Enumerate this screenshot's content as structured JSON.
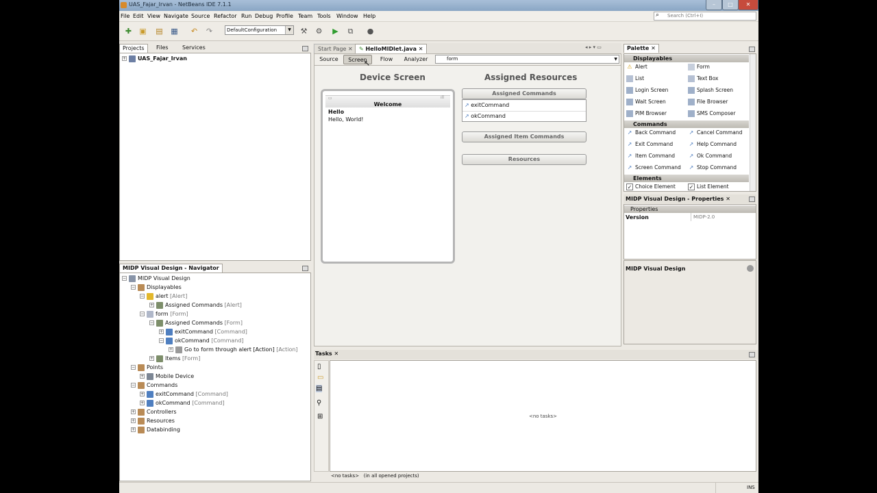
{
  "window": {
    "title": "UAS_Fajar_Irvan - NetBeans IDE 7.1.1"
  },
  "menu": [
    "File",
    "Edit",
    "View",
    "Navigate",
    "Source",
    "Refactor",
    "Run",
    "Debug",
    "Profile",
    "Team",
    "Tools",
    "Window",
    "Help"
  ],
  "search": {
    "placeholder": "Search (Ctrl+I)"
  },
  "toolbar": {
    "config": "DefaultConfiguration"
  },
  "projects_panel": {
    "tabs": [
      "Projects",
      "Files",
      "Services"
    ],
    "root": "UAS_Fajar_Irvan"
  },
  "navigator": {
    "title": "MIDP Visual Design - Navigator",
    "nodes": [
      {
        "label": "MIDP Visual Design",
        "type": ""
      },
      {
        "label": "Displayables",
        "type": ""
      },
      {
        "label": "alert",
        "type": "[Alert]"
      },
      {
        "label": "Assigned Commands",
        "type": "[Alert]"
      },
      {
        "label": "form",
        "type": "[Form]"
      },
      {
        "label": "Assigned Commands",
        "type": "[Form]"
      },
      {
        "label": "exitCommand",
        "type": "[Command]"
      },
      {
        "label": "okCommand",
        "type": "[Command]"
      },
      {
        "label": "Go to form through alert [Action]",
        "type": "[Action]"
      },
      {
        "label": "Items",
        "type": "[Form]"
      },
      {
        "label": "Points",
        "type": ""
      },
      {
        "label": "Mobile Device",
        "type": ""
      },
      {
        "label": "Commands",
        "type": ""
      },
      {
        "label": "exitCommand",
        "type": "[Command]"
      },
      {
        "label": "okCommand",
        "type": "[Command]"
      },
      {
        "label": "Controllers",
        "type": ""
      },
      {
        "label": "Resources",
        "type": ""
      },
      {
        "label": "Databinding",
        "type": ""
      }
    ]
  },
  "editor": {
    "tabs": [
      "Start Page",
      "HelloMIDlet.java"
    ],
    "views": [
      "Source",
      "Screen",
      "Flow",
      "Analyzer"
    ],
    "displayable": "form",
    "device_title": "Device Screen",
    "phone": {
      "header": "Welcome",
      "label": "Hello",
      "text": "Hello, World!"
    },
    "assigned_title": "Assigned Resources",
    "assigned_commands": "Assigned Commands",
    "commands": [
      "exitCommand",
      "okCommand"
    ],
    "item_commands": "Assigned Item Commands",
    "resources": "Resources"
  },
  "palette": {
    "title": "Palette",
    "categories": [
      "Displayables",
      "Commands",
      "Elements"
    ],
    "displayables": [
      "Alert",
      "Form",
      "List",
      "Text Box",
      "Login Screen",
      "Splash Screen",
      "Wait Screen",
      "File Browser",
      "PIM Browser",
      "SMS Composer"
    ],
    "commands": [
      "Back Command",
      "Cancel Command",
      "Exit Command",
      "Help Command",
      "Item Command",
      "Ok Command",
      "Screen Command",
      "Stop Command"
    ],
    "elements": [
      "Choice Element",
      "List Element"
    ]
  },
  "properties": {
    "title": "MIDP Visual Design - Properties",
    "section": "Properties",
    "rows": [
      {
        "name": "Version",
        "value": "MIDP-2.0"
      }
    ],
    "footer": "MIDP Visual Design"
  },
  "tasks": {
    "title": "Tasks",
    "empty": "<no tasks>",
    "status_left": "<no tasks>",
    "status_scope": "(in all opened projects)"
  },
  "statusbar": {
    "mode": "INS"
  }
}
